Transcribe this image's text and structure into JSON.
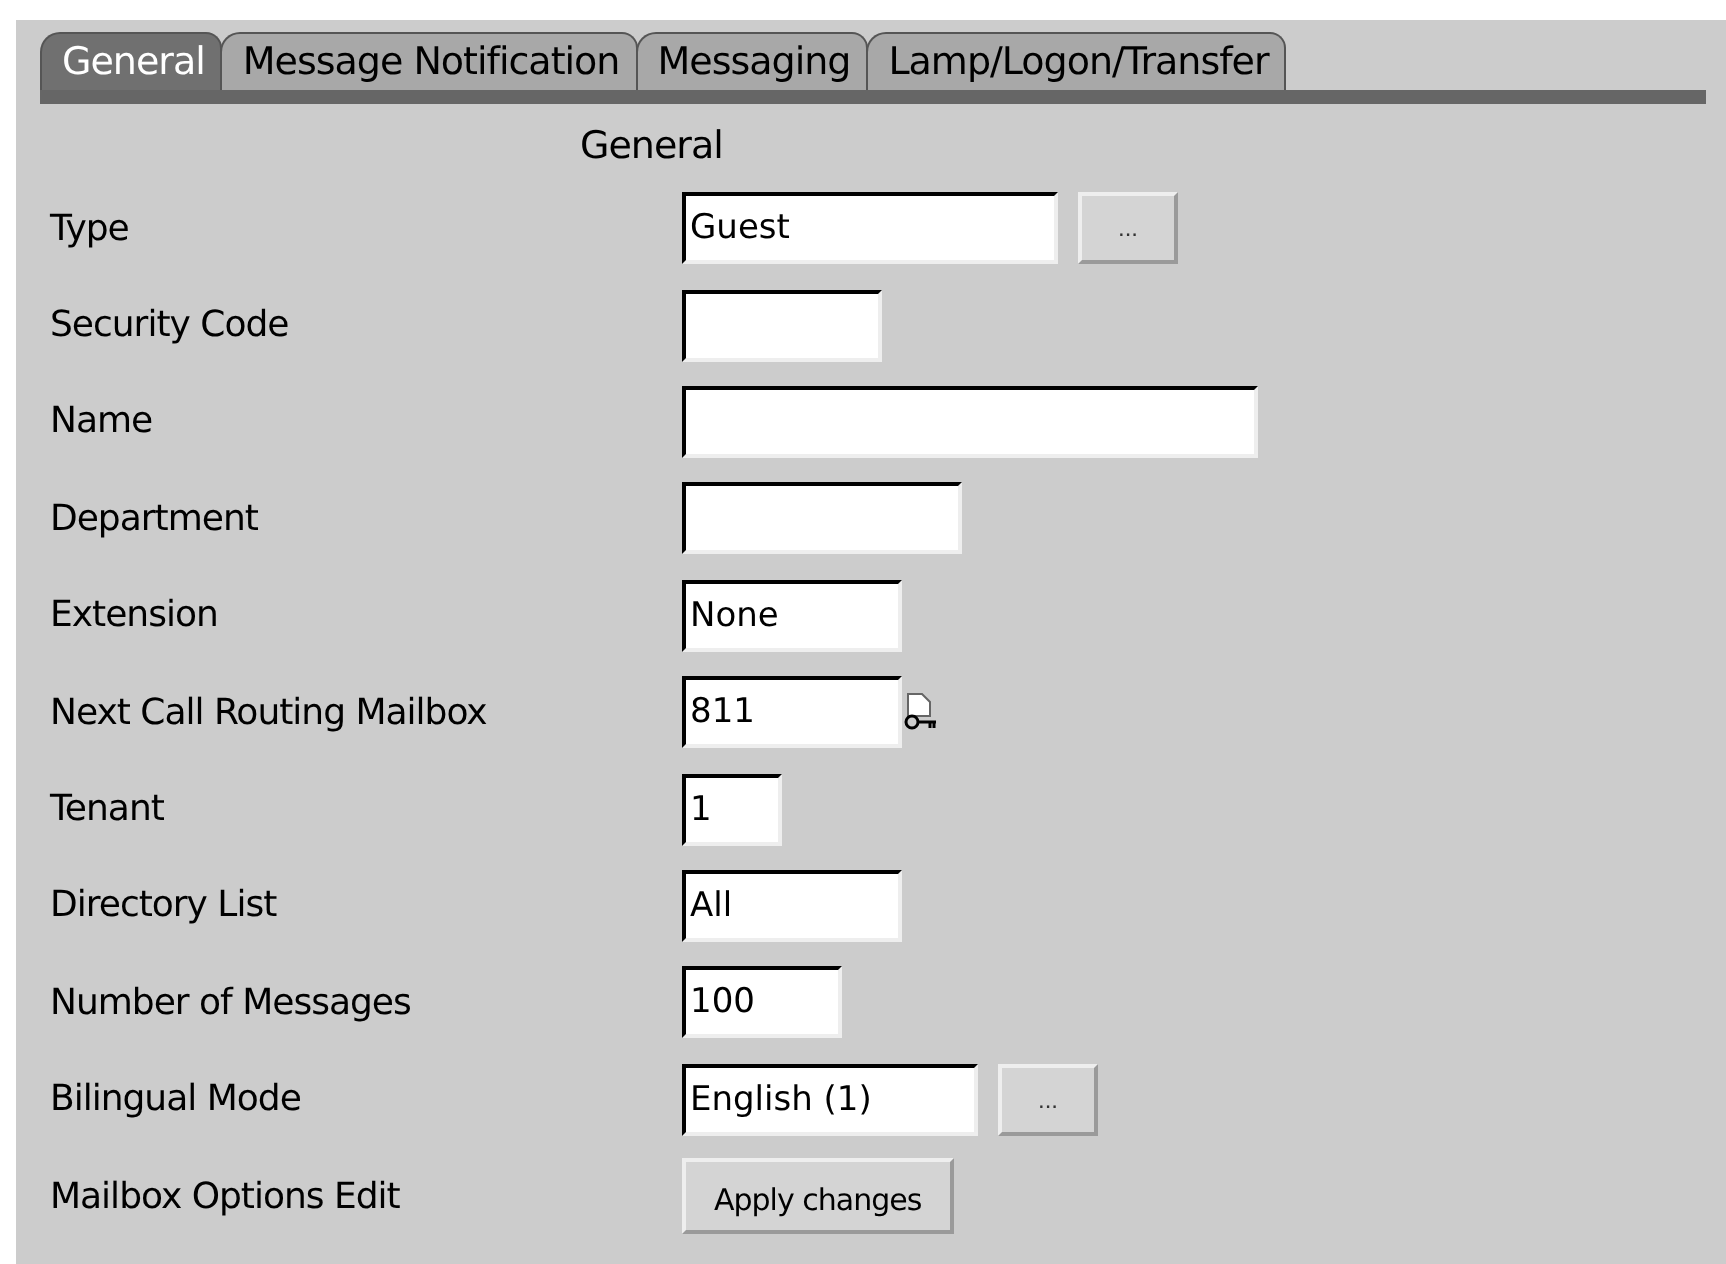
{
  "tabs": [
    {
      "label": "General",
      "selected": true
    },
    {
      "label": "Message Notification",
      "selected": false
    },
    {
      "label": "Messaging",
      "selected": false
    },
    {
      "label": "Lamp/Logon/Transfer",
      "selected": false
    }
  ],
  "section_title": "General",
  "rows": [
    {
      "label": "Type",
      "kind": "text_button",
      "value": "Guest",
      "button": "..."
    },
    {
      "label": "Security Code",
      "kind": "text",
      "value": ""
    },
    {
      "label": "Name",
      "kind": "text",
      "value": ""
    },
    {
      "label": "Department",
      "kind": "text",
      "value": ""
    },
    {
      "label": "Extension",
      "kind": "text",
      "value": "None"
    },
    {
      "label": "Next Call Routing Mailbox",
      "kind": "text_icon",
      "value": "811"
    },
    {
      "label": "Tenant",
      "kind": "text",
      "value": "1"
    },
    {
      "label": "Directory List",
      "kind": "text",
      "value": "All"
    },
    {
      "label": "Number of Messages",
      "kind": "text",
      "value": "100"
    },
    {
      "label": "Bilingual Mode",
      "kind": "text_button",
      "value": "English (1)",
      "button": "..."
    },
    {
      "label": "Mailbox Options Edit",
      "kind": "button",
      "button": "Apply changes"
    }
  ]
}
